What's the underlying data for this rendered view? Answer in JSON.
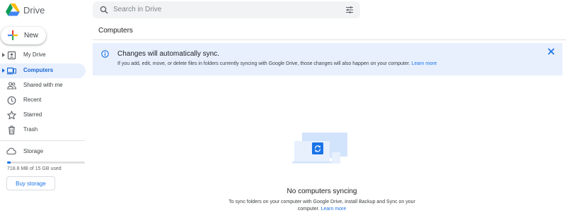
{
  "header": {
    "app_name": "Drive",
    "search_placeholder": "Search in Drive",
    "logo_icon": "google-drive-logo",
    "search_icon": "magnifier",
    "filter_icon": "tune-sliders"
  },
  "sidebar": {
    "new_label": "New",
    "items": [
      {
        "label": "My Drive",
        "icon": "drive-folder-icon",
        "active": false,
        "expandable": true
      },
      {
        "label": "Computers",
        "icon": "computer-icon",
        "active": true,
        "expandable": true
      },
      {
        "label": "Shared with me",
        "icon": "people-icon",
        "active": false,
        "expandable": false
      },
      {
        "label": "Recent",
        "icon": "clock-icon",
        "active": false,
        "expandable": false
      },
      {
        "label": "Starred",
        "icon": "star-icon",
        "active": false,
        "expandable": false
      },
      {
        "label": "Trash",
        "icon": "trash-icon",
        "active": false,
        "expandable": false
      }
    ],
    "storage": {
      "label": "Storage",
      "usage_text": "718.8 MB of 15 GB used",
      "used_fraction": 0.047,
      "buy_label": "Buy storage"
    }
  },
  "main": {
    "title": "Computers",
    "banner": {
      "title": "Changes will automatically sync.",
      "body": "If you add, edit, move, or delete files in folders currently syncing with Google Drive, those changes will also happen on your computer.",
      "link": "Learn more"
    },
    "empty": {
      "title": "No computers syncing",
      "body": "To sync folders on your computer with Google Drive, install Backup and Sync on your computer.",
      "link": "Learn more"
    }
  },
  "colors": {
    "accent": "#1a73e8",
    "active_bg": "#e8f0fe",
    "banner_bg": "#e8f0fe",
    "illustration_light": "#d2e3fc",
    "illustration_dark": "#1a73e8"
  }
}
